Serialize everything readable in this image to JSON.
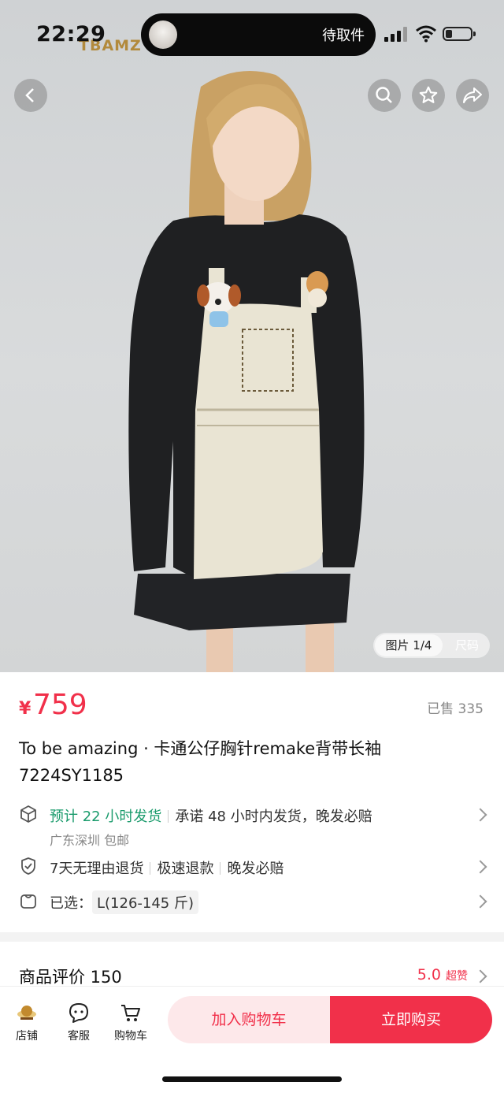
{
  "status_bar": {
    "time": "22:29",
    "brand": "TBAMZ",
    "island_text": "待取件"
  },
  "hero": {
    "pager_label": "图片 1/4",
    "size_label": "尺码"
  },
  "product": {
    "currency": "¥",
    "price": "759",
    "sold": "已售 335",
    "title": "To be amazing · 卡通公仔胸针remake背带长袖7224SY1185"
  },
  "shipping": {
    "eta": "预计 22 小时发货",
    "promise": "承诺 48 小时内发货，晚发必赔",
    "origin": "广东深圳 包邮"
  },
  "guarantee": {
    "items": [
      "7天无理由退货",
      "极速退款",
      "晚发必赔"
    ]
  },
  "selection": {
    "label": "已选：",
    "value": "L(126-145 斤)"
  },
  "reviews": {
    "title": "商品评价 150",
    "score": "5.0",
    "score_tag": "超赞"
  },
  "bottom_bar": {
    "store": "店铺",
    "service": "客服",
    "cart": "购物车",
    "add_to_cart": "加入购物车",
    "buy_now": "立即购买"
  },
  "colors": {
    "accent": "#f1304a",
    "green": "#1a9b6c"
  }
}
